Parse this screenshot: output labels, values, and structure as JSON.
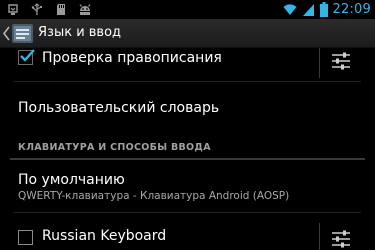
{
  "status_bar": {
    "left_icons": [
      "usb-debug-icon",
      "usb-icon",
      "sd-card-icon",
      "android-icon"
    ],
    "right_icons": [
      "wifi-icon",
      "signal-icon",
      "battery-icon"
    ],
    "time": "22:09",
    "accent": "#33b5e5"
  },
  "action_bar": {
    "title": "Язык и ввод",
    "up_icon": "chevron-left-icon",
    "app_icon": "settings-app-icon"
  },
  "list": {
    "spellcheck": {
      "label": "Проверка правописания",
      "checked": true
    },
    "user_dictionary": {
      "label": "Пользовательский словарь"
    },
    "section_keyboard": {
      "label": "КЛАВИАТУРА И СПОСОБЫ ВВОДА"
    },
    "default_input": {
      "label": "По умолчанию",
      "summary": "QWERTY-клавиатура - Клавиатура Android (AOSP)"
    },
    "russian_keyboard": {
      "label": "Russian Keyboard",
      "checked": false
    }
  }
}
